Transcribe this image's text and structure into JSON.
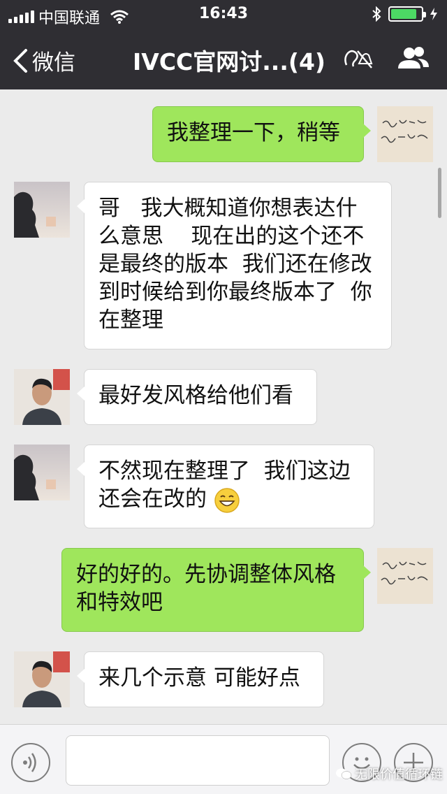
{
  "status_bar": {
    "carrier": "中国联通",
    "time": "16:43",
    "icons": [
      "signal-icon",
      "wifi-icon",
      "bluetooth-icon",
      "battery-icon"
    ],
    "battery_level": 0.85,
    "battery_color": "#4cd964"
  },
  "nav": {
    "back_label": "微信",
    "title": "IVCC官网讨...(4)",
    "icons": [
      "chevron-left-icon",
      "mute-icon",
      "group-icon"
    ]
  },
  "messages": [
    {
      "side": "right",
      "sender": "me",
      "text": "我整理一下，稍等"
    },
    {
      "side": "left",
      "sender": "member-a",
      "text": "哥   我大概知道你想表达什么意思    现在出的这个还不是最终的版本  我们还在修改  到时候给到你最终版本了  你在整理"
    },
    {
      "side": "left",
      "sender": "member-b",
      "text": "最好发风格给他们看"
    },
    {
      "side": "left",
      "sender": "member-a",
      "text": "不然现在整理了  我们这边还会在改的 ",
      "emoji": "grinning-face"
    },
    {
      "side": "right",
      "sender": "me",
      "text": "好的好的。先协调整体风格和特效吧"
    },
    {
      "side": "left",
      "sender": "member-b",
      "text": "来几个示意 可能好点"
    }
  ],
  "input_bar": {
    "icons": [
      "voice-icon",
      "emoji-icon",
      "plus-icon"
    ],
    "placeholder": ""
  },
  "watermark": "无限价值循环链",
  "colors": {
    "header_bg": "#2f2e33",
    "chat_bg": "#ebebeb",
    "bubble_mine": "#9fe65c",
    "bubble_other": "#ffffff"
  }
}
